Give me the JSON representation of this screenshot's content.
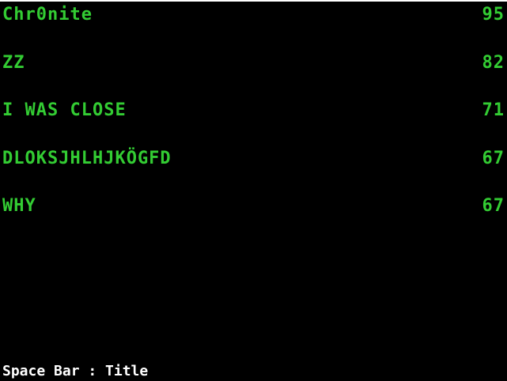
{
  "colors": {
    "background": "#000000",
    "entry_text": "#33cc33",
    "footer_text": "#ffffff"
  },
  "highscores": [
    {
      "name": "Chr0nite",
      "score": "95"
    },
    {
      "name": "ZZ",
      "score": "82"
    },
    {
      "name": "I WAS CLOSE",
      "score": "71"
    },
    {
      "name": "DLOKSJHLHJKÖGFD",
      "score": "67"
    },
    {
      "name": "WHY",
      "score": "67"
    }
  ],
  "footer": {
    "hint": "Space Bar : Title"
  }
}
